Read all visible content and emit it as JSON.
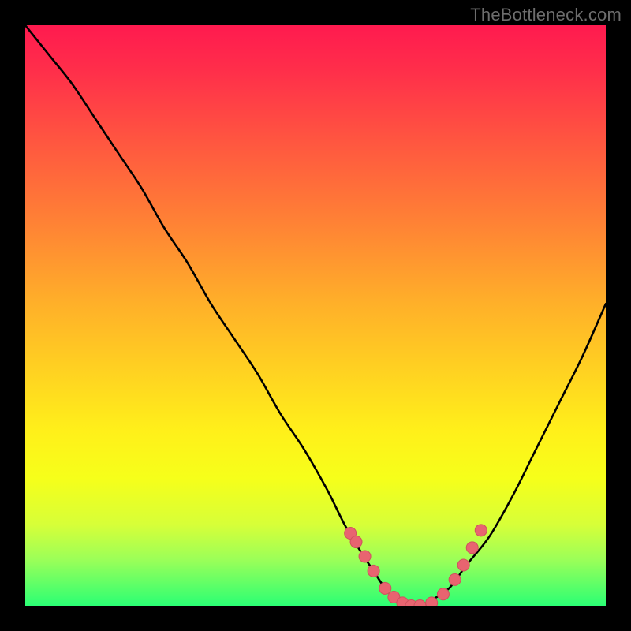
{
  "watermark": "TheBottleneck.com",
  "colors": {
    "page_bg": "#000000",
    "curve_stroke": "#000000",
    "marker_fill": "#e86470",
    "marker_stroke": "#cf525e"
  },
  "chart_data": {
    "type": "line",
    "title": "",
    "xlabel": "",
    "ylabel": "",
    "xlim": [
      0,
      100
    ],
    "ylim": [
      0,
      100
    ],
    "grid": false,
    "legend": false,
    "series": [
      {
        "name": "bottleneck-curve",
        "x": [
          0,
          4,
          8,
          12,
          16,
          20,
          24,
          28,
          32,
          36,
          40,
          44,
          48,
          52,
          55,
          58,
          60,
          62,
          64,
          66,
          68,
          70,
          73,
          76,
          80,
          84,
          88,
          92,
          96,
          100
        ],
        "y": [
          100,
          95,
          90,
          84,
          78,
          72,
          65,
          59,
          52,
          46,
          40,
          33,
          27,
          20,
          14,
          9,
          6,
          3,
          1,
          0,
          0,
          1,
          3,
          7,
          12,
          19,
          27,
          35,
          43,
          52
        ]
      }
    ],
    "markers": {
      "name": "highlighted-points",
      "x": [
        56,
        57,
        58.5,
        60,
        62,
        63.5,
        65,
        66.5,
        68,
        70,
        72,
        74,
        75.5,
        77,
        78.5
      ],
      "y": [
        12.5,
        11,
        8.5,
        6,
        3,
        1.5,
        0.5,
        0,
        0,
        0.5,
        2,
        4.5,
        7,
        10,
        13
      ]
    }
  }
}
